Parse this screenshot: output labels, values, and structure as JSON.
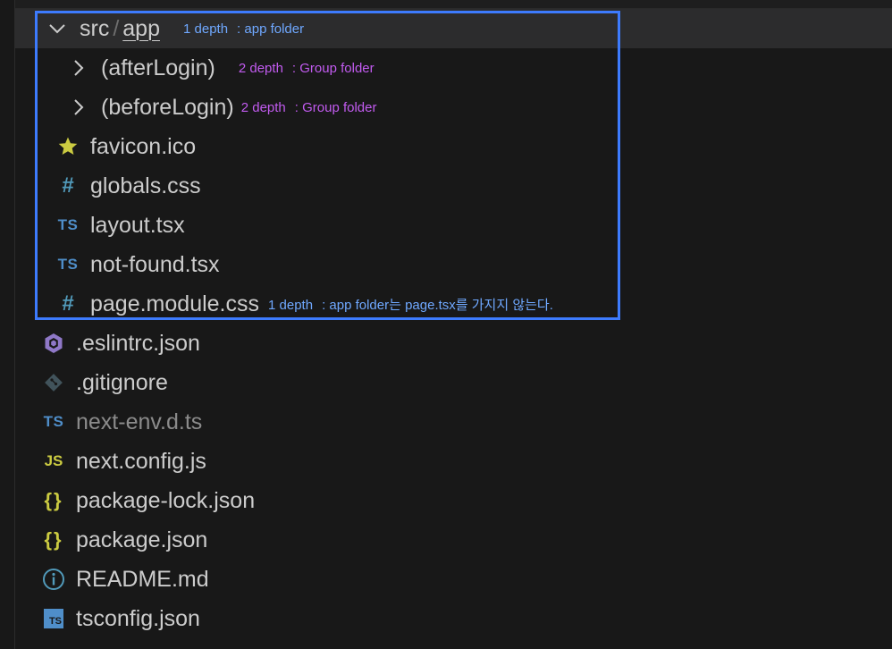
{
  "explorer": {
    "root": {
      "path_part1": "src",
      "path_separator": "/",
      "path_part2": "app",
      "note_depth": "1 depth",
      "note_desc": ": app folder"
    },
    "items": [
      {
        "label": "(afterLogin)",
        "icon": "chevron-right-icon",
        "note_depth": "2 depth",
        "note_desc": ": Group folder"
      },
      {
        "label": "(beforeLogin)",
        "icon": "chevron-right-icon",
        "note_depth": "2 depth",
        "note_desc": ": Group folder"
      },
      {
        "label": "favicon.ico",
        "icon": "star-icon"
      },
      {
        "label": "globals.css",
        "icon": "css-hash-icon",
        "icon_text": "#"
      },
      {
        "label": "layout.tsx",
        "icon": "typescript-icon",
        "icon_text": "TS"
      },
      {
        "label": "not-found.tsx",
        "icon": "typescript-icon",
        "icon_text": "TS"
      },
      {
        "label": "page.module.css",
        "icon": "css-hash-icon",
        "icon_text": "#",
        "note_depth": "1 depth",
        "note_desc": ": app folder는 page.tsx를 가지지 않는다."
      }
    ],
    "root_files": [
      {
        "label": ".eslintrc.json",
        "icon": "eslint-icon"
      },
      {
        "label": ".gitignore",
        "icon": "git-icon"
      },
      {
        "label": "next-env.d.ts",
        "icon": "typescript-icon",
        "icon_text": "TS",
        "dimmed": true
      },
      {
        "label": "next.config.js",
        "icon": "javascript-icon",
        "icon_text": "JS"
      },
      {
        "label": "package-lock.json",
        "icon": "json-braces-icon",
        "icon_text": "{}"
      },
      {
        "label": "package.json",
        "icon": "json-braces-icon",
        "icon_text": "{}"
      },
      {
        "label": "README.md",
        "icon": "info-icon"
      },
      {
        "label": "tsconfig.json",
        "icon": "tsconfig-icon",
        "icon_text": "TS"
      }
    ]
  },
  "colors": {
    "background": "#181818",
    "selected_row": "#2c2c2d",
    "highlight_border": "#3d7bfd",
    "note_blue": "#6fa8ff",
    "note_purple": "#c25bf0",
    "ts_blue": "#4f8ec9",
    "css_blue": "#519aba",
    "json_yellow": "#cbcb41",
    "eslint_purple": "#8f78c7"
  }
}
